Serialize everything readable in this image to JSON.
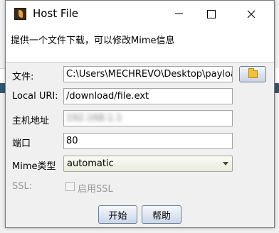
{
  "window": {
    "title": "Host File"
  },
  "description": "提供一个文件下载，可以修改Mime信息",
  "form": {
    "file": {
      "label": "文件:",
      "value": "C:\\Users\\MECHREVO\\Desktop\\payloa"
    },
    "uri": {
      "label": "Local URI:",
      "value": "/download/file.ext"
    },
    "host": {
      "label": "主机地址",
      "value": "192.168.1.1"
    },
    "port": {
      "label": "端口",
      "value": "80"
    },
    "mime": {
      "label": "Mime类型",
      "value": "automatic"
    },
    "ssl": {
      "label": "SSL:",
      "checkbox_label": "启用SSL"
    }
  },
  "buttons": {
    "start": "开始",
    "help": "帮助"
  },
  "icons": {
    "browse": "folder-icon",
    "app": "app-icon"
  }
}
